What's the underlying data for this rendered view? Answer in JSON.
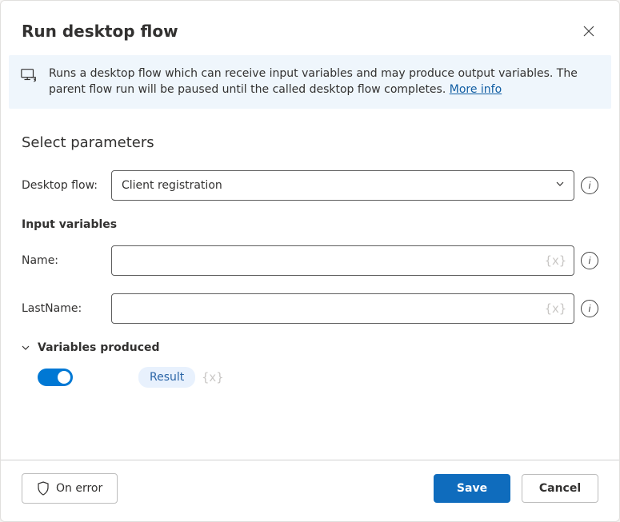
{
  "dialog": {
    "title": "Run desktop flow",
    "description": "Runs a desktop flow which can receive input variables and may produce output variables. The parent flow run will be paused until the called desktop flow completes.",
    "more_info_label": "More info"
  },
  "parameters": {
    "section_title": "Select parameters",
    "desktop_flow": {
      "label": "Desktop flow:",
      "value": "Client registration"
    },
    "input_variables_title": "Input variables",
    "inputs": {
      "name": {
        "label": "Name:",
        "value": ""
      },
      "lastname": {
        "label": "LastName:",
        "value": ""
      }
    },
    "variable_token": "{x}"
  },
  "produced": {
    "section_title": "Variables produced",
    "toggle_on": true,
    "result_chip": "Result"
  },
  "footer": {
    "on_error": "On error",
    "save": "Save",
    "cancel": "Cancel"
  }
}
